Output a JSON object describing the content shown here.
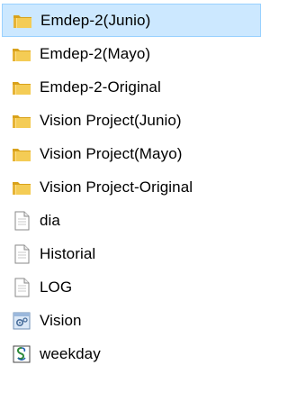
{
  "files": [
    {
      "name": "Emdep-2(Junio)",
      "type": "folder",
      "icon": "folder-icon",
      "selected": true
    },
    {
      "name": "Emdep-2(Mayo)",
      "type": "folder",
      "icon": "folder-icon",
      "selected": false
    },
    {
      "name": "Emdep-2-Original",
      "type": "folder",
      "icon": "folder-icon",
      "selected": false
    },
    {
      "name": "Vision Project(Junio)",
      "type": "folder",
      "icon": "folder-icon",
      "selected": false
    },
    {
      "name": "Vision Project(Mayo)",
      "type": "folder",
      "icon": "folder-icon",
      "selected": false
    },
    {
      "name": "Vision Project-Original",
      "type": "folder",
      "icon": "folder-icon",
      "selected": false
    },
    {
      "name": "dia",
      "type": "file",
      "icon": "document-icon",
      "selected": false
    },
    {
      "name": "Historial",
      "type": "file",
      "icon": "document-icon",
      "selected": false
    },
    {
      "name": "LOG",
      "type": "file",
      "icon": "document-icon",
      "selected": false
    },
    {
      "name": "Vision",
      "type": "settings-file",
      "icon": "settings-file-icon",
      "selected": false
    },
    {
      "name": "weekday",
      "type": "script",
      "icon": "script-icon",
      "selected": false
    }
  ],
  "colors": {
    "selection_bg": "#cce8ff",
    "selection_border": "#99d1ff",
    "folder_yellow": "#f2c84b",
    "folder_dark": "#d9a21b",
    "text": "#000000"
  }
}
